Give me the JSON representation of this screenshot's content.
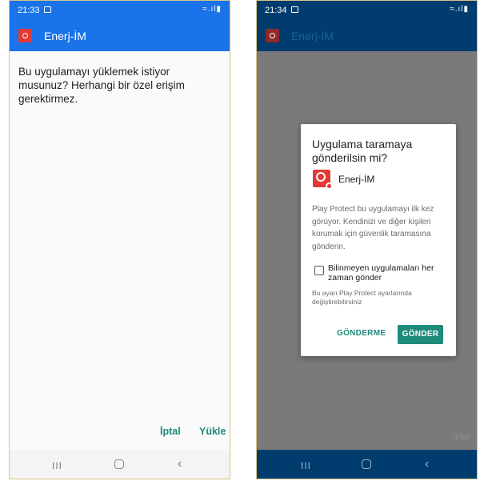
{
  "left": {
    "status": {
      "time": "21:33"
    },
    "appbar": {
      "title": "Enerj-İM"
    },
    "prompt": "Bu uygulamayı yüklemek istiyor musunuz? Herhangi bir özel erişim gerektirmez.",
    "actions": {
      "cancel": "İptal",
      "install": "Yükle"
    },
    "nav": {
      "recent": "III",
      "back": "‹"
    },
    "colors": {
      "appbar": "#1a73e8",
      "statusbar": "#1a73e8",
      "accent": "#1e8a7a"
    }
  },
  "right": {
    "status": {
      "time": "21:34"
    },
    "appbar": {
      "title": "Enerj-İM"
    },
    "dialog": {
      "title": "Uygulama taramaya gönderilsin mi?",
      "app_name": "Enerj-İM",
      "description": "Play Protect bu uygulamayı ilk kez görüyor. Kendinizi ve diğer kişileri korumak için güvenlik taramasına gönderin.",
      "checkbox_label": "Bilinmeyen uygulamaları her zaman gönder",
      "note": "Bu ayarı Play Protect ayarlarında değiştirebilirsiniz",
      "btn_dont_send": "GÖNDERME",
      "btn_send": "GÖNDER"
    },
    "faded_cancel": "İptal",
    "nav": {
      "recent": "III",
      "back": "‹"
    },
    "colors": {
      "appbar": "#003d6e",
      "statusbar": "#003d6e",
      "accent": "#1e8a7a"
    }
  }
}
